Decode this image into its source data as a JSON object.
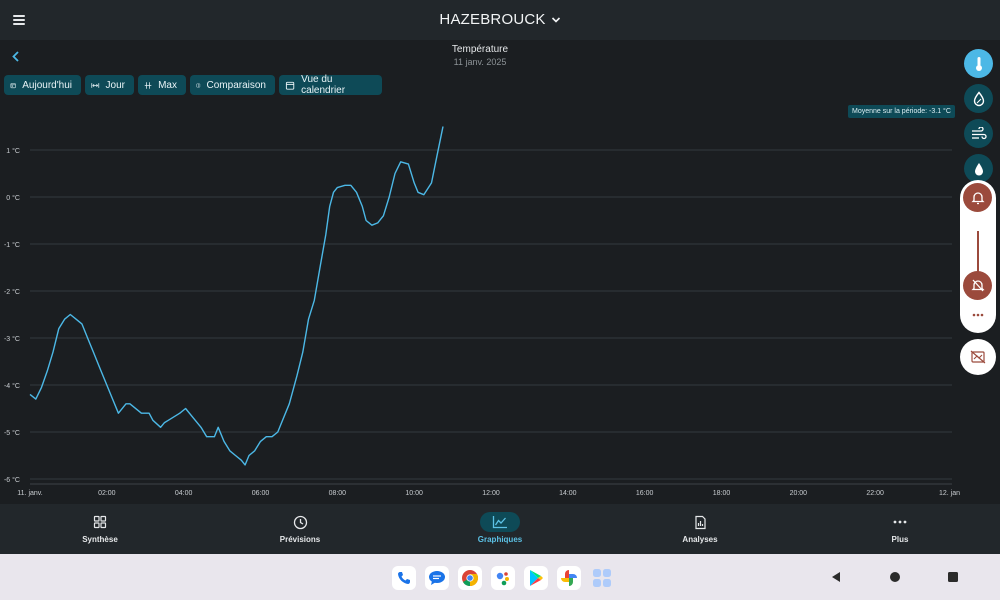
{
  "header": {
    "city": "HAZEBROUCK"
  },
  "chart_header": {
    "title": "Température",
    "date": "11 janv. 2025"
  },
  "chips": [
    {
      "label": "Aujourd'hui",
      "icon": "calendar-icon"
    },
    {
      "label": "Jour",
      "icon": "range-icon"
    },
    {
      "label": "Max",
      "icon": "max-icon"
    },
    {
      "label": "Comparaison",
      "icon": "compare-icon"
    },
    {
      "label": "Vue du calendrier",
      "icon": "calendar-view-icon"
    }
  ],
  "average_badge": "Moyenne sur la période: -3.1 °C",
  "chart_data": {
    "type": "line",
    "title": "Température",
    "xlabel": "",
    "ylabel": "",
    "y_unit": "°C",
    "ylim": [
      -6,
      1.5
    ],
    "y_ticks": [
      "1 °C",
      "0 °C",
      "-1 °C",
      "-2 °C",
      "-3 °C",
      "-4 °C",
      "-5 °C",
      "-6 °C"
    ],
    "y_tick_values": [
      1,
      0,
      -1,
      -2,
      -3,
      -4,
      -5,
      -6
    ],
    "xlim_hours": [
      0,
      24
    ],
    "x_ticks": [
      "11. janv.",
      "02:00",
      "04:00",
      "06:00",
      "08:00",
      "10:00",
      "12:00",
      "14:00",
      "16:00",
      "18:00",
      "20:00",
      "22:00",
      "12. janv."
    ],
    "x_tick_hours": [
      0,
      2,
      4,
      6,
      8,
      10,
      12,
      14,
      16,
      18,
      20,
      22,
      24
    ],
    "grid": true,
    "line_color": "#4cb8e6",
    "series": [
      {
        "x_hours": [
          0.0,
          0.15,
          0.3,
          0.45,
          0.6,
          0.75,
          0.9,
          1.05,
          1.2,
          1.35,
          1.5,
          1.65,
          1.8,
          2.0,
          2.15,
          2.3,
          2.5,
          2.6,
          2.9,
          3.1,
          3.2,
          3.4,
          3.5,
          3.6,
          3.9,
          4.05,
          4.25,
          4.45,
          4.6,
          4.8,
          4.9,
          5.05,
          5.2,
          5.35,
          5.5,
          5.6,
          5.7,
          5.85,
          6.0,
          6.15,
          6.3,
          6.45,
          6.55,
          6.75,
          6.95,
          7.1,
          7.25,
          7.4,
          7.55,
          7.7,
          7.8,
          7.9,
          8.0,
          8.2,
          8.35,
          8.5,
          8.65,
          8.75,
          8.9,
          9.05,
          9.2,
          9.35,
          9.5,
          9.65,
          9.85,
          10.0,
          10.1,
          10.25,
          10.45,
          10.6,
          10.75
        ],
        "values": [
          -4.2,
          -4.3,
          -4.05,
          -3.7,
          -3.3,
          -2.8,
          -2.6,
          -2.5,
          -2.6,
          -2.7,
          -3.0,
          -3.3,
          -3.6,
          -4.0,
          -4.3,
          -4.6,
          -4.4,
          -4.4,
          -4.6,
          -4.6,
          -4.75,
          -4.9,
          -4.8,
          -4.75,
          -4.6,
          -4.5,
          -4.7,
          -4.9,
          -5.1,
          -5.1,
          -4.9,
          -5.2,
          -5.4,
          -5.5,
          -5.6,
          -5.7,
          -5.5,
          -5.4,
          -5.2,
          -5.1,
          -5.1,
          -5.0,
          -4.8,
          -4.4,
          -3.8,
          -3.3,
          -2.6,
          -2.2,
          -1.5,
          -0.8,
          -0.2,
          0.1,
          0.2,
          0.25,
          0.25,
          0.1,
          -0.2,
          -0.5,
          -0.6,
          -0.55,
          -0.4,
          0.0,
          0.5,
          0.75,
          0.7,
          0.3,
          0.1,
          0.05,
          0.3,
          0.9,
          1.5
        ]
      }
    ]
  },
  "nav": [
    {
      "label": "Synthèse",
      "icon": "grid-icon",
      "active": false
    },
    {
      "label": "Prévisions",
      "icon": "clock-icon",
      "active": false
    },
    {
      "label": "Graphiques",
      "icon": "chart-icon",
      "active": true
    },
    {
      "label": "Analyses",
      "icon": "report-icon",
      "active": false
    },
    {
      "label": "Plus",
      "icon": "more-icon",
      "active": false
    }
  ],
  "dock_apps": [
    "phone-icon",
    "messages-icon",
    "chrome-icon",
    "assistant-icon",
    "play-store-icon",
    "photos-icon",
    "app-drawer-icon"
  ],
  "colors": {
    "accent": "#4cb8e6",
    "chip": "#0e4a57",
    "alert": "#9b4a3c",
    "background": "#1b1e21"
  }
}
